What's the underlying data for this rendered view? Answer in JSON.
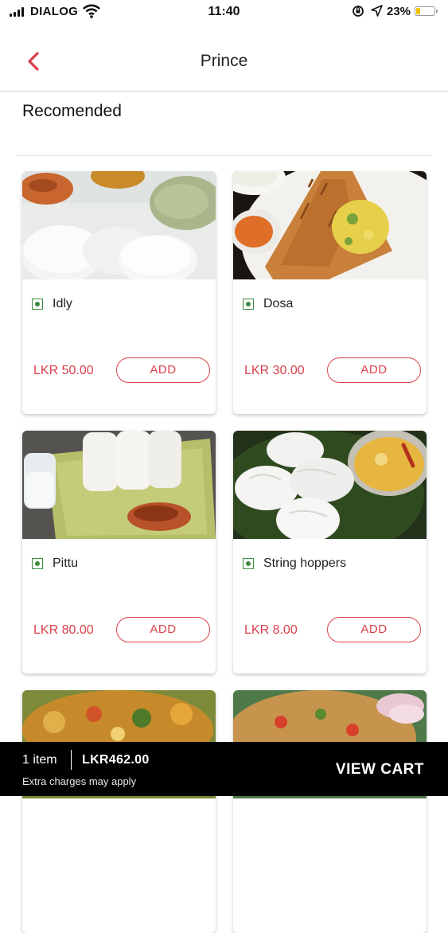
{
  "status_bar": {
    "carrier": "DIALOG",
    "time": "11:40",
    "battery_percent": "23%",
    "battery_color": "#f2c300"
  },
  "nav": {
    "title": "Prince",
    "back_icon": "chevron-left-icon",
    "accent": "#d9404b"
  },
  "section": {
    "title": "Recomended"
  },
  "items": [
    {
      "name": "Idly",
      "price": "LKR 50.00",
      "add_label": "ADD",
      "veg": true
    },
    {
      "name": "Dosa",
      "price": "LKR 30.00",
      "add_label": "ADD",
      "veg": true
    },
    {
      "name": "Pittu",
      "price": "LKR 80.00",
      "add_label": "ADD",
      "veg": true
    },
    {
      "name": "String hoppers",
      "price": "LKR 8.00",
      "add_label": "ADD",
      "veg": true
    },
    {
      "name": "",
      "price": "",
      "add_label": "",
      "veg": true
    },
    {
      "name": "",
      "price": "",
      "add_label": "",
      "veg": true
    }
  ],
  "cart": {
    "count": "1 item",
    "total": "LKR462.00",
    "note": "Extra charges may apply",
    "action": "VIEW CART"
  }
}
